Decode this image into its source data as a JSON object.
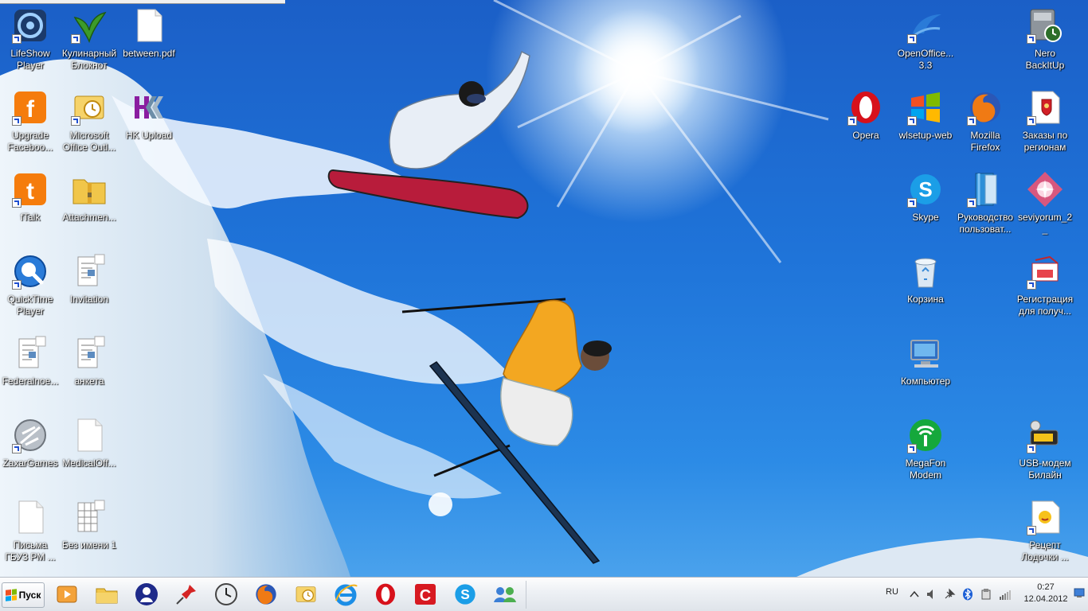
{
  "desktop": {
    "icons": [
      {
        "name": "lifeshow-player",
        "label": "LifeShow Player",
        "icon": "lifeshow-icon",
        "shortcut": true
      },
      {
        "name": "kulinarny-bloknot",
        "label": "Кулинарный Блокнот",
        "icon": "herb-icon",
        "shortcut": true
      },
      {
        "name": "between-pdf",
        "label": "between.pdf",
        "icon": "blank-document-icon",
        "shortcut": false
      },
      {
        "name": "upgrade-facebook",
        "label": "Upgrade Faceboo...",
        "icon": "facebook-icon",
        "shortcut": true
      },
      {
        "name": "ms-office-outlook",
        "label": "Microsoft Office Outl...",
        "icon": "outlook-icon",
        "shortcut": true
      },
      {
        "name": "hk-upload",
        "label": "HK Upload",
        "icon": "hk-logo-icon",
        "shortcut": false
      },
      {
        "name": "ftalk",
        "label": "fTalk",
        "icon": "ftalk-icon",
        "shortcut": true
      },
      {
        "name": "attachments",
        "label": "Attachmen...",
        "icon": "zip-folder-icon",
        "shortcut": false
      },
      {
        "name": "quicktime-player",
        "label": "QuickTime Player",
        "icon": "quicktime-icon",
        "shortcut": true
      },
      {
        "name": "invitation",
        "label": "Invitation",
        "icon": "wordpad-document-icon",
        "shortcut": false
      },
      {
        "name": "federalnoe",
        "label": "Federalnoe...",
        "icon": "wordpad-document-icon",
        "shortcut": false
      },
      {
        "name": "anketa",
        "label": "анкета",
        "icon": "wordpad-document-icon",
        "shortcut": false
      },
      {
        "name": "zaxargames",
        "label": "ZaxarGames",
        "icon": "zaxar-icon",
        "shortcut": true
      },
      {
        "name": "medicaloff",
        "label": "MedicalOff...",
        "icon": "blank-document-icon",
        "shortcut": false
      },
      {
        "name": "pisma-gbuz",
        "label": "Письма ГБУЗ РМ ...",
        "icon": "blank-document-icon",
        "shortcut": false
      },
      {
        "name": "bez-imeni-1",
        "label": "Без имени 1",
        "icon": "spreadsheet-document-icon",
        "shortcut": false
      },
      {
        "name": "openoffice",
        "label": "OpenOffice... 3.3",
        "icon": "openoffice-icon",
        "shortcut": true
      },
      {
        "name": "nero-backitup",
        "label": "Nero BackItUp",
        "icon": "nero-backitup-icon",
        "shortcut": true
      },
      {
        "name": "opera",
        "label": "Opera",
        "icon": "opera-icon",
        "shortcut": true
      },
      {
        "name": "wlsetup-web",
        "label": "wlsetup-web",
        "icon": "windows-logo-icon",
        "shortcut": true
      },
      {
        "name": "mozilla-firefox",
        "label": "Mozilla Firefox",
        "icon": "firefox-icon",
        "shortcut": true
      },
      {
        "name": "zakazy-po-regionam",
        "label": "Заказы по регионам",
        "icon": "coat-of-arms-document-icon",
        "shortcut": true
      },
      {
        "name": "skype",
        "label": "Skype",
        "icon": "skype-icon",
        "shortcut": true
      },
      {
        "name": "rukovodstvo",
        "label": "Руководство пользоват...",
        "icon": "book-icon",
        "shortcut": true
      },
      {
        "name": "seviyorum",
        "label": "seviyorum_2_",
        "icon": "pink-star-icon",
        "shortcut": false
      },
      {
        "name": "korzina",
        "label": "Корзина",
        "icon": "recycle-bin-icon",
        "shortcut": false
      },
      {
        "name": "registratsiya",
        "label": "Регистрация для получ...",
        "icon": "registration-icon",
        "shortcut": true
      },
      {
        "name": "kompyuter",
        "label": "Компьютер",
        "icon": "computer-icon",
        "shortcut": false
      },
      {
        "name": "megafon-modem",
        "label": "MegaFon Modem",
        "icon": "megafon-icon",
        "shortcut": true
      },
      {
        "name": "usb-modem-beeline",
        "label": "USB-модем Билайн",
        "icon": "usb-modem-icon",
        "shortcut": true
      },
      {
        "name": "recept-lodochki",
        "label": "Рецепт Лодочки ...",
        "icon": "recipe-document-icon",
        "shortcut": true
      }
    ]
  },
  "taskbar": {
    "start_label": "Пуск",
    "pinned": [
      {
        "name": "media-player",
        "icon": "media-player-icon"
      },
      {
        "name": "explorer",
        "icon": "folder-icon"
      },
      {
        "name": "user-agent",
        "icon": "person-icon"
      },
      {
        "name": "pushpin",
        "icon": "pushpin-icon"
      },
      {
        "name": "clock-app",
        "icon": "clock-icon"
      },
      {
        "name": "firefox",
        "icon": "firefox-icon"
      },
      {
        "name": "outlook",
        "icon": "outlook-icon"
      },
      {
        "name": "internet-explorer",
        "icon": "ie-icon"
      },
      {
        "name": "opera",
        "icon": "opera-icon"
      },
      {
        "name": "c-app",
        "icon": "red-c-icon"
      },
      {
        "name": "skype",
        "icon": "skype-icon"
      },
      {
        "name": "network-people",
        "icon": "people-network-icon"
      }
    ],
    "tray": {
      "language": "RU",
      "time": "0:27",
      "date": "12.04.2012"
    }
  },
  "colors": {
    "sky": "#1f74d9",
    "label_text": "#ffffff",
    "taskbar": "#e8ecf1"
  }
}
